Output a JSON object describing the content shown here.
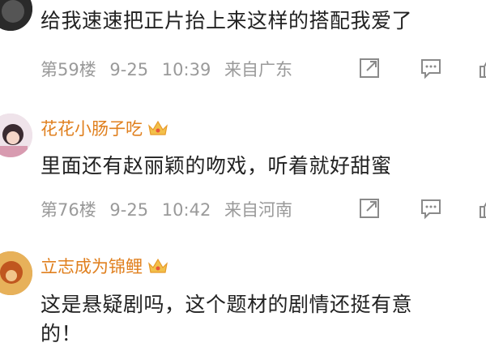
{
  "comments": [
    {
      "text": "给我速速把正片抬上来这样的搭配我爱了",
      "floor": "第59楼",
      "date": "9-25",
      "time": "10:39",
      "location": "来自广东"
    },
    {
      "username": "花花小肠子吃",
      "text": "里面还有赵丽颖的吻戏，听着就好甜蜜",
      "floor": "第76楼",
      "date": "9-25",
      "time": "10:42",
      "location": "来自河南"
    },
    {
      "username": "立志成为锦鲤",
      "text": "这是悬疑剧吗，这个题材的剧情还挺有意",
      "text_line2": "的！"
    }
  ],
  "colors": {
    "username": "#e0801f",
    "meta": "#9a9a9a",
    "text": "#222222",
    "icon": "#8a8a8a"
  },
  "icons": [
    "share-icon",
    "comment-icon",
    "like-icon",
    "crown-badge-icon"
  ]
}
